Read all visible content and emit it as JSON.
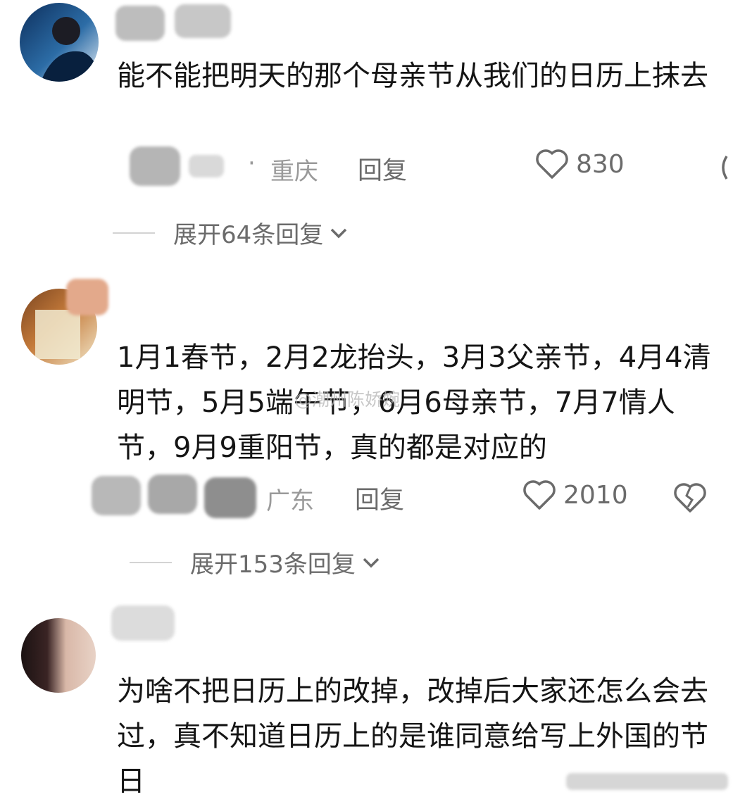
{
  "watermark": "@潮州陈娇婉",
  "comments": [
    {
      "text": "能不能把明天的那个母亲节从我们的日历上抹去",
      "location": "重庆",
      "reply_label": "回复",
      "likes": "830",
      "expand_label": "展开64条回复"
    },
    {
      "text": "1月1春节，2月2龙抬头，3月3父亲节，4月4清明节，5月5端午节，6月6母亲节，7月7情人节，9月9重阳节，真的都是对应的",
      "location": "广东",
      "reply_label": "回复",
      "likes": "2010",
      "expand_label": "展开153条回复"
    },
    {
      "text": "为啥不把日历上的改掉，改掉后大家还怎么会去过，真不知道日历上的是谁同意给写上外国的节日"
    }
  ],
  "colors": {
    "text": "#151515",
    "meta": "#9a9a9a",
    "action": "#6b6b6b",
    "divider": "#d3d3d3"
  }
}
